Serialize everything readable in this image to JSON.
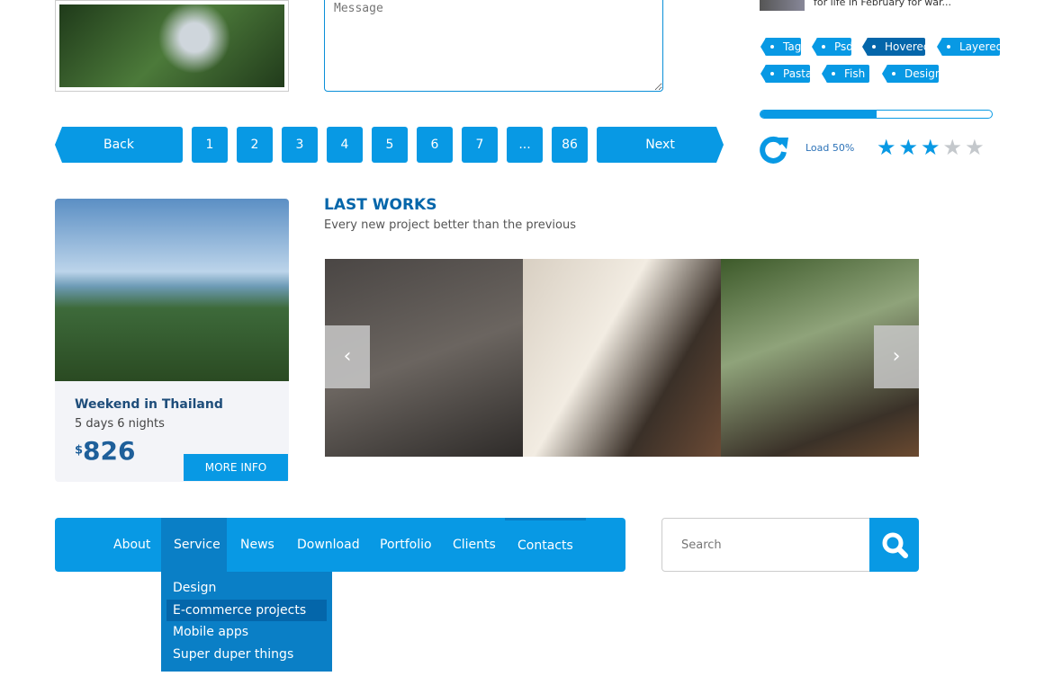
{
  "contact": {
    "message_placeholder": "Message"
  },
  "news": {
    "teaser": "for life in February for war..."
  },
  "tags": [
    {
      "label": "Tag"
    },
    {
      "label": "Psd"
    },
    {
      "label": "Hovered"
    },
    {
      "label": "Layered"
    },
    {
      "label": "Pasta"
    },
    {
      "label": "Fish"
    },
    {
      "label": "Design"
    }
  ],
  "progress": {
    "percent": 50,
    "label": "Load 50%"
  },
  "rating": {
    "value": 3,
    "max": 5
  },
  "pagination": {
    "back": "Back",
    "pages": [
      "1",
      "2",
      "3",
      "4",
      "5",
      "6",
      "7",
      "...",
      "86"
    ],
    "next": "Next"
  },
  "offer": {
    "title": "Weekend in Thailand",
    "duration": "5 days 6 nights",
    "currency": "$",
    "price": "826",
    "button": "MORE INFO"
  },
  "works": {
    "title": "LAST WORKS",
    "subtitle": "Every new project better than the previous",
    "prev": "‹",
    "next": "›"
  },
  "nav": {
    "items": [
      "About",
      "Service",
      "News",
      "Download",
      "Portfolio",
      "Clients",
      "Contacts"
    ],
    "active": "Service",
    "dropdown": [
      "Design",
      "E-commerce projects",
      "Mobile apps",
      "Super duper things"
    ]
  },
  "search": {
    "placeholder": "Search"
  },
  "colors": {
    "accent": "#0899e4",
    "dark": "#0466aa"
  }
}
